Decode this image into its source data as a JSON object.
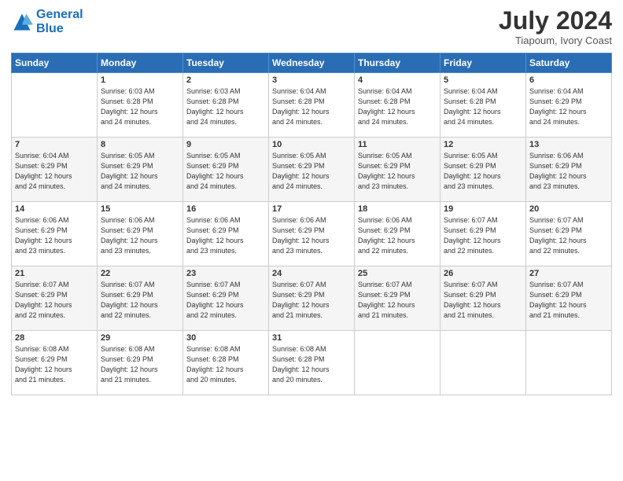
{
  "logo": {
    "line1": "General",
    "line2": "Blue"
  },
  "title": "July 2024",
  "location": "Tiapoum, Ivory Coast",
  "days_header": [
    "Sunday",
    "Monday",
    "Tuesday",
    "Wednesday",
    "Thursday",
    "Friday",
    "Saturday"
  ],
  "weeks": [
    [
      {
        "day": "",
        "info": ""
      },
      {
        "day": "1",
        "info": "Sunrise: 6:03 AM\nSunset: 6:28 PM\nDaylight: 12 hours\nand 24 minutes."
      },
      {
        "day": "2",
        "info": "Sunrise: 6:03 AM\nSunset: 6:28 PM\nDaylight: 12 hours\nand 24 minutes."
      },
      {
        "day": "3",
        "info": "Sunrise: 6:04 AM\nSunset: 6:28 PM\nDaylight: 12 hours\nand 24 minutes."
      },
      {
        "day": "4",
        "info": "Sunrise: 6:04 AM\nSunset: 6:28 PM\nDaylight: 12 hours\nand 24 minutes."
      },
      {
        "day": "5",
        "info": "Sunrise: 6:04 AM\nSunset: 6:28 PM\nDaylight: 12 hours\nand 24 minutes."
      },
      {
        "day": "6",
        "info": "Sunrise: 6:04 AM\nSunset: 6:29 PM\nDaylight: 12 hours\nand 24 minutes."
      }
    ],
    [
      {
        "day": "7",
        "info": ""
      },
      {
        "day": "8",
        "info": "Sunrise: 6:05 AM\nSunset: 6:29 PM\nDaylight: 12 hours\nand 24 minutes."
      },
      {
        "day": "9",
        "info": "Sunrise: 6:05 AM\nSunset: 6:29 PM\nDaylight: 12 hours\nand 24 minutes."
      },
      {
        "day": "10",
        "info": "Sunrise: 6:05 AM\nSunset: 6:29 PM\nDaylight: 12 hours\nand 24 minutes."
      },
      {
        "day": "11",
        "info": "Sunrise: 6:05 AM\nSunset: 6:29 PM\nDaylight: 12 hours\nand 23 minutes."
      },
      {
        "day": "12",
        "info": "Sunrise: 6:05 AM\nSunset: 6:29 PM\nDaylight: 12 hours\nand 23 minutes."
      },
      {
        "day": "13",
        "info": "Sunrise: 6:06 AM\nSunset: 6:29 PM\nDaylight: 12 hours\nand 23 minutes."
      }
    ],
    [
      {
        "day": "14",
        "info": ""
      },
      {
        "day": "15",
        "info": "Sunrise: 6:06 AM\nSunset: 6:29 PM\nDaylight: 12 hours\nand 23 minutes."
      },
      {
        "day": "16",
        "info": "Sunrise: 6:06 AM\nSunset: 6:29 PM\nDaylight: 12 hours\nand 23 minutes."
      },
      {
        "day": "17",
        "info": "Sunrise: 6:06 AM\nSunset: 6:29 PM\nDaylight: 12 hours\nand 23 minutes."
      },
      {
        "day": "18",
        "info": "Sunrise: 6:06 AM\nSunset: 6:29 PM\nDaylight: 12 hours\nand 22 minutes."
      },
      {
        "day": "19",
        "info": "Sunrise: 6:07 AM\nSunset: 6:29 PM\nDaylight: 12 hours\nand 22 minutes."
      },
      {
        "day": "20",
        "info": "Sunrise: 6:07 AM\nSunset: 6:29 PM\nDaylight: 12 hours\nand 22 minutes."
      }
    ],
    [
      {
        "day": "21",
        "info": ""
      },
      {
        "day": "22",
        "info": "Sunrise: 6:07 AM\nSunset: 6:29 PM\nDaylight: 12 hours\nand 22 minutes."
      },
      {
        "day": "23",
        "info": "Sunrise: 6:07 AM\nSunset: 6:29 PM\nDaylight: 12 hours\nand 22 minutes."
      },
      {
        "day": "24",
        "info": "Sunrise: 6:07 AM\nSunset: 6:29 PM\nDaylight: 12 hours\nand 21 minutes."
      },
      {
        "day": "25",
        "info": "Sunrise: 6:07 AM\nSunset: 6:29 PM\nDaylight: 12 hours\nand 21 minutes."
      },
      {
        "day": "26",
        "info": "Sunrise: 6:07 AM\nSunset: 6:29 PM\nDaylight: 12 hours\nand 21 minutes."
      },
      {
        "day": "27",
        "info": "Sunrise: 6:07 AM\nSunset: 6:29 PM\nDaylight: 12 hours\nand 21 minutes."
      }
    ],
    [
      {
        "day": "28",
        "info": "Sunrise: 6:08 AM\nSunset: 6:29 PM\nDaylight: 12 hours\nand 21 minutes."
      },
      {
        "day": "29",
        "info": "Sunrise: 6:08 AM\nSunset: 6:29 PM\nDaylight: 12 hours\nand 21 minutes."
      },
      {
        "day": "30",
        "info": "Sunrise: 6:08 AM\nSunset: 6:28 PM\nDaylight: 12 hours\nand 20 minutes."
      },
      {
        "day": "31",
        "info": "Sunrise: 6:08 AM\nSunset: 6:28 PM\nDaylight: 12 hours\nand 20 minutes."
      },
      {
        "day": "",
        "info": ""
      },
      {
        "day": "",
        "info": ""
      },
      {
        "day": "",
        "info": ""
      }
    ]
  ],
  "week7_sunday": "Sunrise: 6:04 AM\nSunset: 6:29 PM\nDaylight: 12 hours\nand 24 minutes.",
  "week14_sunday": "Sunrise: 6:06 AM\nSunset: 6:29 PM\nDaylight: 12 hours\nand 23 minutes.",
  "week21_sunday": "Sunrise: 6:07 AM\nSunset: 6:29 PM\nDaylight: 12 hours\nand 22 minutes."
}
